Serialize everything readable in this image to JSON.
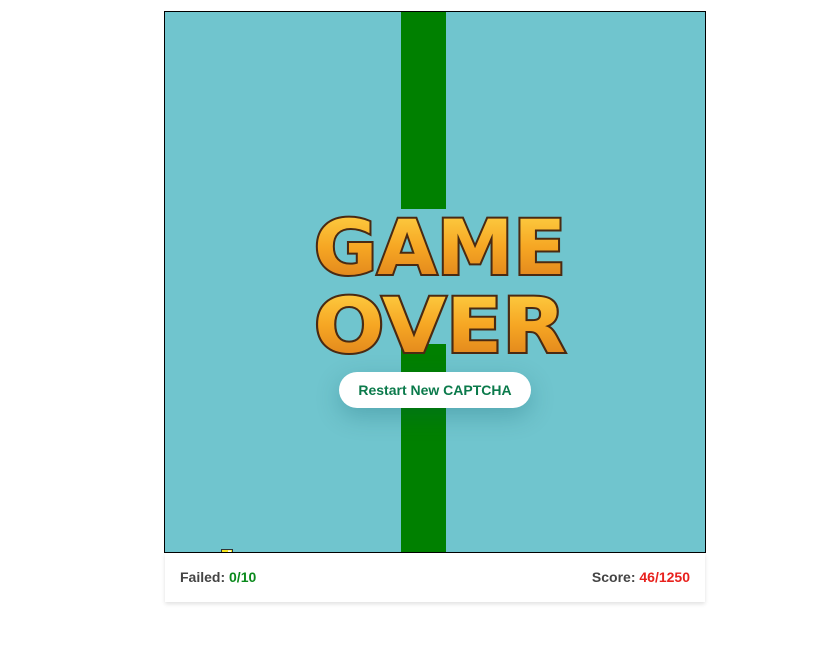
{
  "game": {
    "banner_line1": "GAME",
    "banner_line2": "OVER",
    "restart_label": "Restart New CAPTCHA"
  },
  "stats": {
    "failed_label": "Failed: ",
    "failed_value": "0/10",
    "score_label": "Score: ",
    "score_value": "46/1250"
  },
  "colors": {
    "sky": "#70c5ce",
    "pipe": "#008000",
    "failed_value": "#0a8a1c",
    "score_value": "#e8211d",
    "button_text": "#0b7a4b"
  },
  "icons": {
    "bird": "bird-icon"
  }
}
